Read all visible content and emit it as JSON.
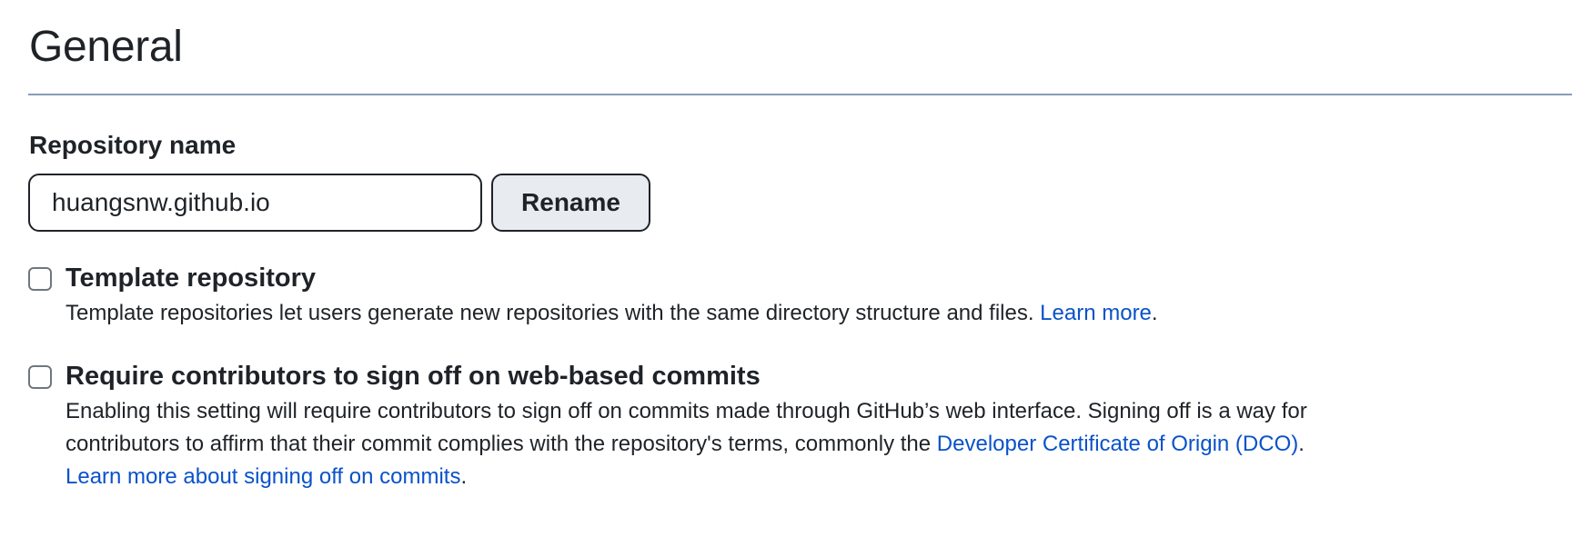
{
  "header": {
    "title": "General"
  },
  "repository_name": {
    "label": "Repository name",
    "value": "huangsnw.github.io",
    "rename_label": "Rename"
  },
  "template_option": {
    "checked": false,
    "title": "Template repository",
    "description": "Template repositories let users generate new repositories with the same directory structure and files. ",
    "link": "Learn more",
    "suffix": "."
  },
  "signoff_option": {
    "checked": false,
    "title": "Require contributors to sign off on web-based commits",
    "description": "Enabling this setting will require contributors to sign off on commits made through GitHub’s web interface. Signing off is a way for contributors to affirm that their commit complies with the repository's terms, commonly the ",
    "dco_link": "Developer Certificate of Origin (DCO)",
    "mid": ".",
    "learn_link": "Learn more about signing off on commits",
    "suffix": "."
  },
  "colors": {
    "link": "#0a52c9",
    "button_bg": "#e8ecf1",
    "divider": "#8a9bb8",
    "text": "#1f2328"
  }
}
